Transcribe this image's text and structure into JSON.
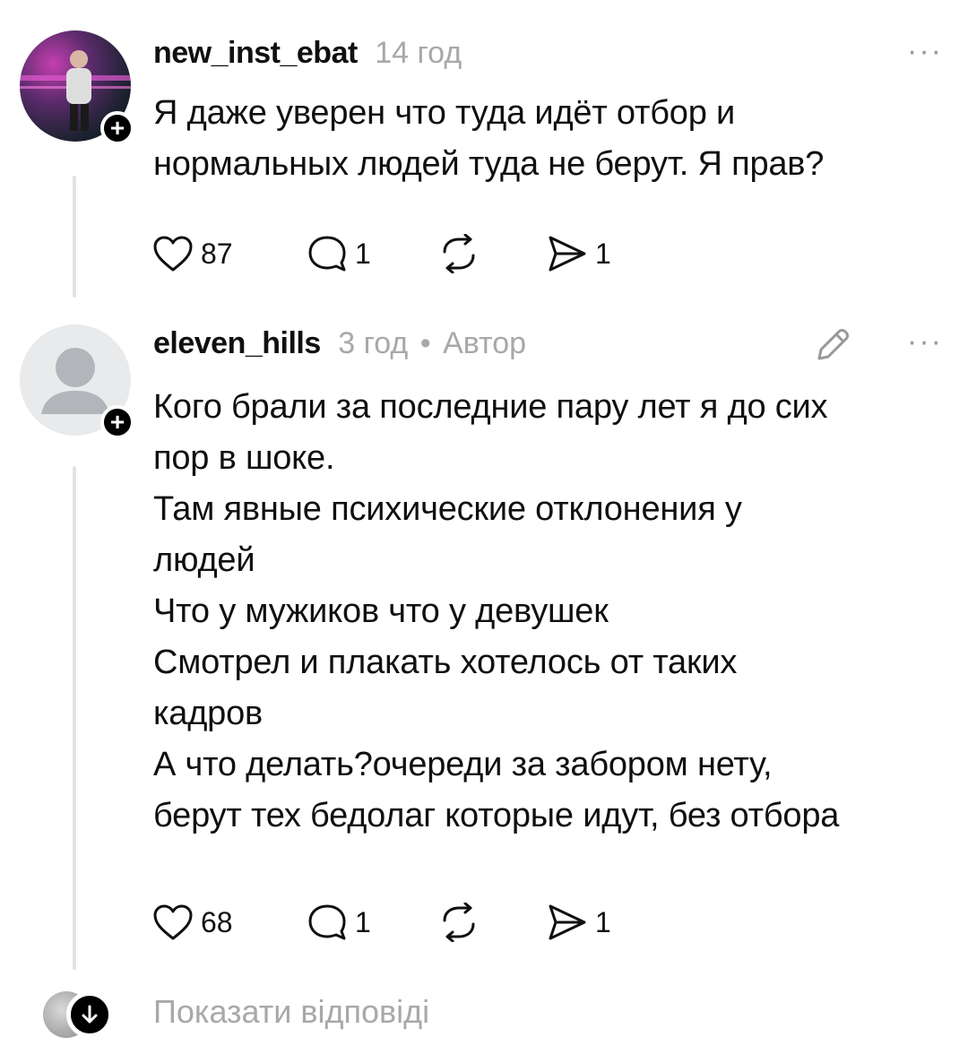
{
  "comments": [
    {
      "username": "new_inst_ebat",
      "time": "14 год",
      "author_tag": "",
      "more": "···",
      "lines": [
        "Я даже уверен что туда идёт отбор и",
        "нормальных людей туда не берут. Я прав?"
      ],
      "likes": "87",
      "replies": "1",
      "shares": "1"
    },
    {
      "username": "eleven_hills",
      "time": "3 год",
      "separator": "•",
      "author_tag": "Автор",
      "more": "···",
      "lines": [
        "Кого брали за последние пару лет я до сих",
        "пор в шоке.",
        "Там явные психические отклонения у",
        "людей",
        "Что у мужиков что у девушек",
        "Смотрел и плакать хотелось от таких",
        "кадров",
        "А что делать?очереди за забором нету,",
        "берут тех бедолаг которые идут, без отбора"
      ],
      "likes": "68",
      "replies": "1",
      "shares": "1"
    }
  ],
  "show_replies": "Показати відповіді",
  "icons": {
    "like": "heart-icon",
    "reply": "comment-bubble-icon",
    "repost": "repost-icon",
    "share": "send-icon",
    "edit": "pencil-icon",
    "follow": "plus-icon",
    "expand": "arrow-down-icon"
  }
}
